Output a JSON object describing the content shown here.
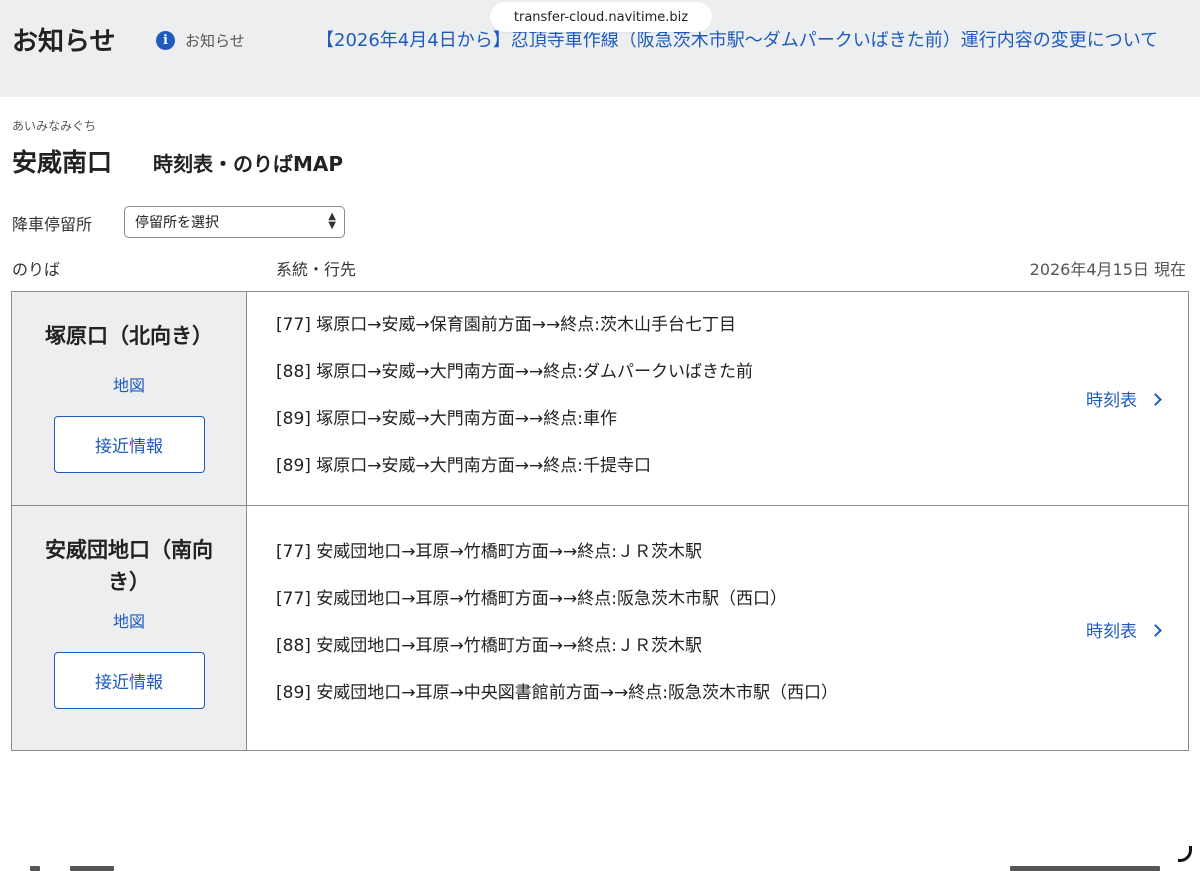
{
  "browser": {
    "url": "transfer-cloud.navitime.biz"
  },
  "notice": {
    "title": "お知らせ",
    "tag_icon": "info-icon",
    "tag_label": "お知らせ",
    "headline": "【2026年4月4日から】忍頂寺車作線（阪急茨木市駅〜ダムパークいばきた前）運行内容の変更について"
  },
  "stop": {
    "reading": "あいみなみぐち",
    "name": "安威南口",
    "subtitle": "時刻表・のりばMAP"
  },
  "alight_filter": {
    "label": "降車停留所",
    "selected": "停留所を選択"
  },
  "table_header": {
    "platform": "のりば",
    "route": "系統・行先",
    "as_of": "2026年4月15日  現在"
  },
  "platforms": [
    {
      "name": "塚原口（北向き）",
      "map_label": "地図",
      "approach_label": "接近情報",
      "timetable_label": "時刻表",
      "routes": [
        "[77] 塚原口→安威→保育園前方面→→終点:茨木山手台七丁目",
        "[88] 塚原口→安威→大門南方面→→終点:ダムパークいばきた前",
        "[89] 塚原口→安威→大門南方面→→終点:車作",
        "[89] 塚原口→安威→大門南方面→→終点:千提寺口"
      ]
    },
    {
      "name": "安威団地口（南向き）",
      "map_label": "地図",
      "approach_label": "接近情報",
      "timetable_label": "時刻表",
      "routes": [
        "[77] 安威団地口→耳原→竹橋町方面→→終点:ＪＲ茨木駅",
        "[77] 安威団地口→耳原→竹橋町方面→→終点:阪急茨木市駅（西口）",
        "[88] 安威団地口→耳原→竹橋町方面→→終点:ＪＲ茨木駅",
        "[89] 安威団地口→耳原→中央図書館前方面→→終点:阪急茨木市駅（西口）"
      ]
    }
  ],
  "colors": {
    "link": "#1f5bbd",
    "band": "#eceef0",
    "border": "#8c8c8c"
  }
}
